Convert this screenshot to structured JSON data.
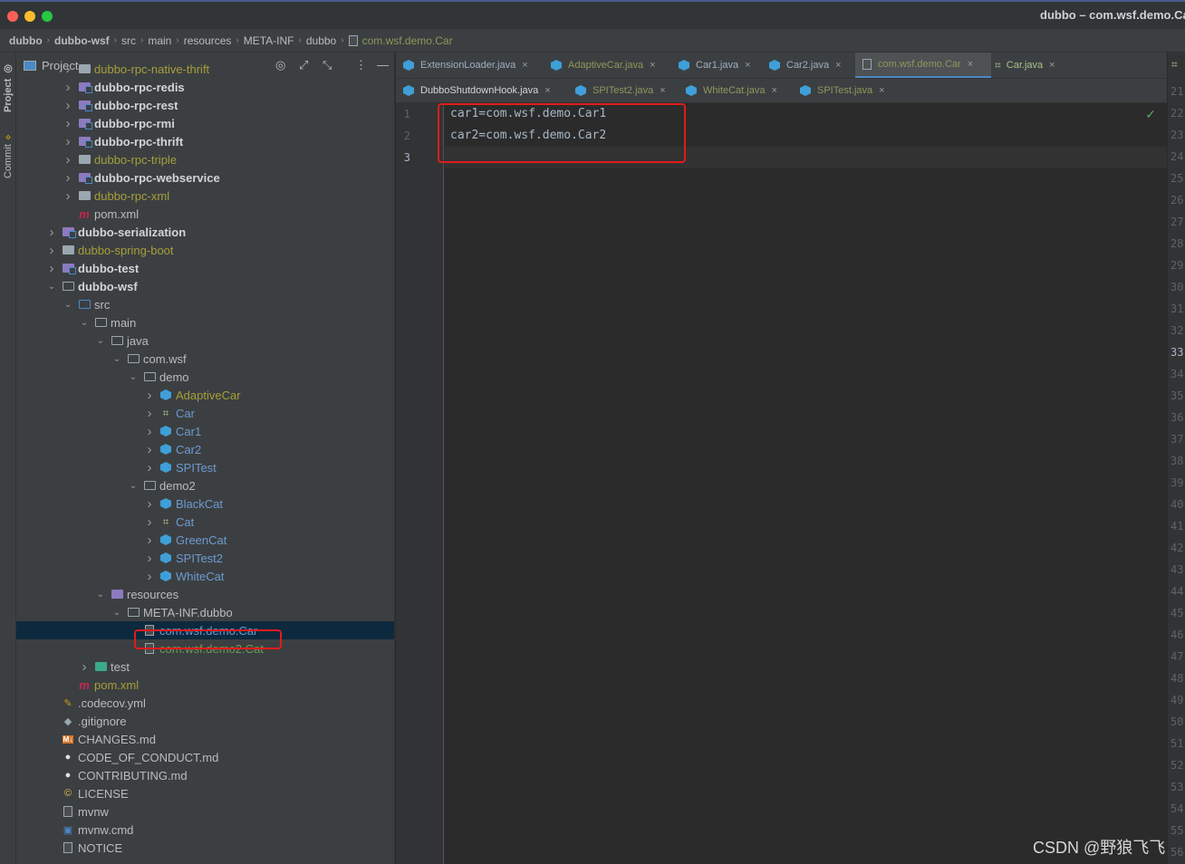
{
  "window": {
    "title": "dubbo – com.wsf.demo.Car",
    "colors": {
      "close": "#fe5f57",
      "minimize": "#febc2e",
      "maximize": "#28c840"
    }
  },
  "breadcrumb": [
    "dubbo",
    "dubbo-wsf",
    "src",
    "main",
    "resources",
    "META-INF",
    "dubbo",
    "com.wsf.demo.Car"
  ],
  "sidebar_tabs": [
    "Project",
    "Commit"
  ],
  "project_panel": {
    "title": "Project"
  },
  "tree": [
    {
      "label": "dubbo-rpc-native-thrift",
      "depth": 2,
      "arrow": ">",
      "icon": "folder-filled",
      "style": "olive"
    },
    {
      "label": "dubbo-rpc-redis",
      "depth": 2,
      "arrow": ">",
      "icon": "module-folder",
      "style": "bold"
    },
    {
      "label": "dubbo-rpc-rest",
      "depth": 2,
      "arrow": ">",
      "icon": "module-folder",
      "style": "bold"
    },
    {
      "label": "dubbo-rpc-rmi",
      "depth": 2,
      "arrow": ">",
      "icon": "module-folder",
      "style": "bold"
    },
    {
      "label": "dubbo-rpc-thrift",
      "depth": 2,
      "arrow": ">",
      "icon": "module-folder",
      "style": "bold"
    },
    {
      "label": "dubbo-rpc-triple",
      "depth": 2,
      "arrow": ">",
      "icon": "folder-filled",
      "style": "olive"
    },
    {
      "label": "dubbo-rpc-webservice",
      "depth": 2,
      "arrow": ">",
      "icon": "module-folder",
      "style": "bold"
    },
    {
      "label": "dubbo-rpc-xml",
      "depth": 2,
      "arrow": ">",
      "icon": "folder-filled",
      "style": "olive"
    },
    {
      "label": "pom.xml",
      "depth": 2,
      "arrow": "",
      "icon": "maven",
      "style": "normal"
    },
    {
      "label": "dubbo-serialization",
      "depth": 1,
      "arrow": ">",
      "icon": "module-folder",
      "style": "bold"
    },
    {
      "label": "dubbo-spring-boot",
      "depth": 1,
      "arrow": ">",
      "icon": "folder-filled",
      "style": "olive"
    },
    {
      "label": "dubbo-test",
      "depth": 1,
      "arrow": ">",
      "icon": "module-folder",
      "style": "bold"
    },
    {
      "label": "dubbo-wsf",
      "depth": 1,
      "arrow": "v",
      "icon": "folder",
      "style": "bold"
    },
    {
      "label": "src",
      "depth": 2,
      "arrow": "v",
      "icon": "src-folder",
      "style": "normal"
    },
    {
      "label": "main",
      "depth": 3,
      "arrow": "v",
      "icon": "folder",
      "style": "normal"
    },
    {
      "label": "java",
      "depth": 4,
      "arrow": "v",
      "icon": "folder",
      "style": "normal"
    },
    {
      "label": "com.wsf",
      "depth": 5,
      "arrow": "v",
      "icon": "folder",
      "style": "normal"
    },
    {
      "label": "demo",
      "depth": 6,
      "arrow": "v",
      "icon": "folder",
      "style": "normal"
    },
    {
      "label": "AdaptiveCar",
      "depth": 7,
      "arrow": ">",
      "icon": "java-class",
      "style": "olive"
    },
    {
      "label": "Car",
      "depth": 7,
      "arrow": ">",
      "icon": "annotation",
      "style": "blue"
    },
    {
      "label": "Car1",
      "depth": 7,
      "arrow": ">",
      "icon": "java-class",
      "style": "blue"
    },
    {
      "label": "Car2",
      "depth": 7,
      "arrow": ">",
      "icon": "java-class",
      "style": "blue"
    },
    {
      "label": "SPITest",
      "depth": 7,
      "arrow": ">",
      "icon": "java-class",
      "style": "blue"
    },
    {
      "label": "demo2",
      "depth": 6,
      "arrow": "v",
      "icon": "folder",
      "style": "normal"
    },
    {
      "label": "BlackCat",
      "depth": 7,
      "arrow": ">",
      "icon": "java-class",
      "style": "blue"
    },
    {
      "label": "Cat",
      "depth": 7,
      "arrow": ">",
      "icon": "annotation",
      "style": "blue"
    },
    {
      "label": "GreenCat",
      "depth": 7,
      "arrow": ">",
      "icon": "java-class",
      "style": "blue"
    },
    {
      "label": "SPITest2",
      "depth": 7,
      "arrow": ">",
      "icon": "java-class",
      "style": "blue"
    },
    {
      "label": "WhiteCat",
      "depth": 7,
      "arrow": ">",
      "icon": "java-class",
      "style": "blue"
    },
    {
      "label": "resources",
      "depth": 4,
      "arrow": "v",
      "icon": "resources-folder",
      "style": "normal"
    },
    {
      "label": "META-INF.dubbo",
      "depth": 5,
      "arrow": "v",
      "icon": "folder",
      "style": "normal"
    },
    {
      "label": "com.wsf.demo.Car",
      "depth": 6,
      "arrow": "",
      "icon": "text-file",
      "style": "blue",
      "selected": true
    },
    {
      "label": "com.wsf.demo2.Cat",
      "depth": 6,
      "arrow": "",
      "icon": "text-file",
      "style": "green"
    },
    {
      "label": "test",
      "depth": 3,
      "arrow": ">",
      "icon": "test-folder",
      "style": "normal"
    },
    {
      "label": "pom.xml",
      "depth": 2,
      "arrow": "",
      "icon": "maven",
      "style": "olive"
    },
    {
      "label": ".codecov.yml",
      "depth": 1,
      "arrow": "",
      "icon": "yaml",
      "style": "normal"
    },
    {
      "label": ".gitignore",
      "depth": 1,
      "arrow": "",
      "icon": "git",
      "style": "normal"
    },
    {
      "label": "CHANGES.md",
      "depth": 1,
      "arrow": "",
      "icon": "markdown",
      "style": "normal"
    },
    {
      "label": "CODE_OF_CONDUCT.md",
      "depth": 1,
      "arrow": "",
      "icon": "github",
      "style": "normal"
    },
    {
      "label": "CONTRIBUTING.md",
      "depth": 1,
      "arrow": "",
      "icon": "github",
      "style": "normal"
    },
    {
      "label": "LICENSE",
      "depth": 1,
      "arrow": "",
      "icon": "license",
      "style": "normal"
    },
    {
      "label": "mvnw",
      "depth": 1,
      "arrow": "",
      "icon": "script",
      "style": "normal"
    },
    {
      "label": "mvnw.cmd",
      "depth": 1,
      "arrow": "",
      "icon": "cmd",
      "style": "normal"
    },
    {
      "label": "NOTICE",
      "depth": 1,
      "arrow": "",
      "icon": "script",
      "style": "normal"
    }
  ],
  "tabs_row1": [
    {
      "label": "ExtensionLoader.java",
      "icon": "java-class"
    },
    {
      "label": "AdaptiveCar.java",
      "icon": "java-class",
      "style": "olive"
    },
    {
      "label": "Car1.java",
      "icon": "java-class"
    },
    {
      "label": "Car2.java",
      "icon": "java-class"
    },
    {
      "label": "com.wsf.demo.Car",
      "icon": "text-file",
      "active": true,
      "style": "olive"
    },
    {
      "label": "Car.java",
      "icon": "annotation",
      "closeable": true
    }
  ],
  "tabs_row2": [
    {
      "label": "DubboShutdownHook.java",
      "icon": "java-class",
      "style": "dark"
    },
    {
      "label": "SPITest2.java",
      "icon": "java-class",
      "style": "olive"
    },
    {
      "label": "WhiteCat.java",
      "icon": "java-class",
      "style": "olive"
    },
    {
      "label": "SPITest.java",
      "icon": "java-class",
      "style": "olive"
    }
  ],
  "editor": {
    "lines": [
      "car1=com.wsf.demo.Car1",
      "car2=com.wsf.demo.Car2",
      ""
    ],
    "line_numbers": [
      "1",
      "2",
      "3"
    ],
    "status_icon": "check-icon"
  },
  "right_line_numbers": [
    "21",
    "22",
    "23",
    "24",
    "25",
    "26",
    "27",
    "28",
    "29",
    "30",
    "31",
    "32",
    "33",
    "34",
    "35",
    "36",
    "37",
    "38",
    "39",
    "40",
    "41",
    "42",
    "43",
    "44",
    "45",
    "46",
    "47",
    "48",
    "49",
    "50",
    "51",
    "52",
    "53",
    "54",
    "55",
    "56"
  ],
  "watermark": "CSDN @野狼飞飞"
}
